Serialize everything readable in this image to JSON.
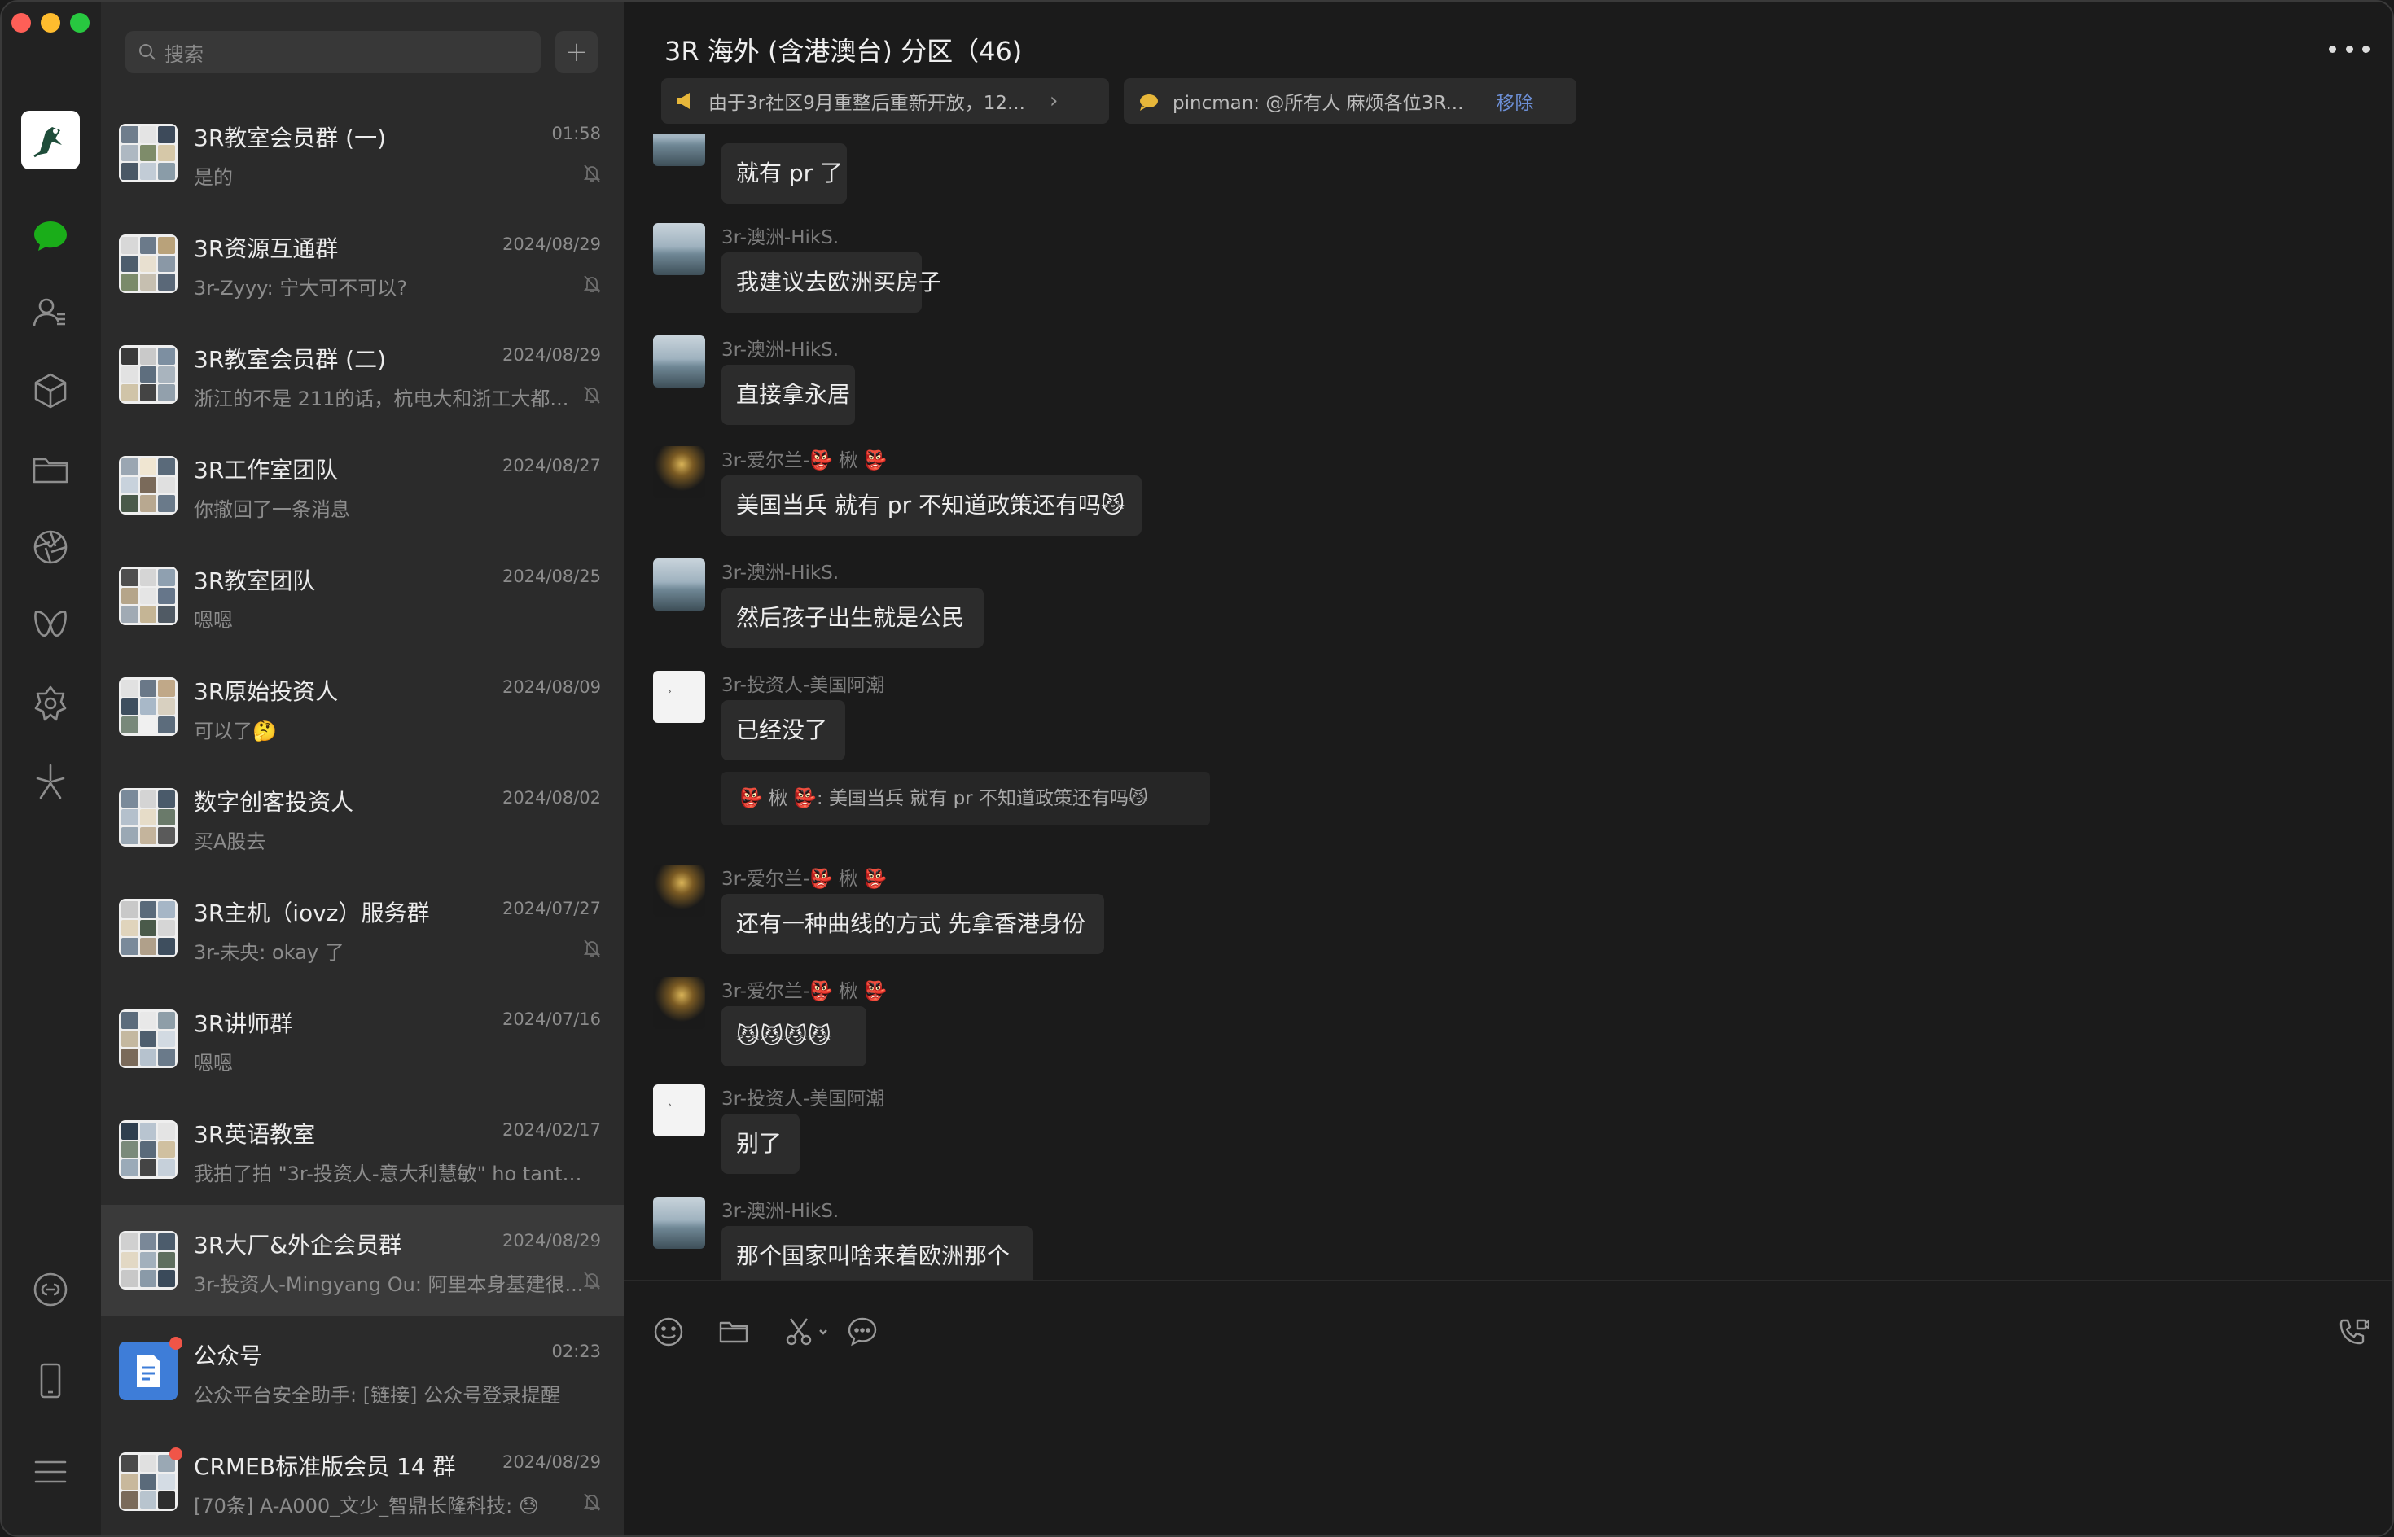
{
  "window": {
    "traffic_colors": [
      "#fe5f57",
      "#febc2e",
      "#28c840"
    ]
  },
  "rail": {
    "icons": [
      "chat-icon",
      "contacts-icon",
      "box-icon",
      "folder-icon",
      "moments-icon",
      "channels-icon",
      "mini-program-icon",
      "search-glint-icon",
      "link-icon",
      "phone-icon",
      "menu-icon"
    ]
  },
  "search": {
    "placeholder": "搜索"
  },
  "chats": [
    {
      "name": "3R教室会员群 (一)",
      "time": "01:58",
      "preview": "是的",
      "muted": true,
      "selected": false
    },
    {
      "name": "3R资源互通群",
      "time": "2024/08/29",
      "preview": "3r-Zyyy: 宁大可不可以?",
      "muted": true,
      "selected": false
    },
    {
      "name": "3R教室会员群 (二)",
      "time": "2024/08/29",
      "preview": "浙江的不是 211的话，杭电大和浙工大都...",
      "muted": true,
      "selected": false
    },
    {
      "name": "3R工作室团队",
      "time": "2024/08/27",
      "preview": "你撤回了一条消息",
      "muted": false,
      "selected": false
    },
    {
      "name": "3R教室团队",
      "time": "2024/08/25",
      "preview": "嗯嗯",
      "muted": false,
      "selected": false
    },
    {
      "name": "3R原始投资人",
      "time": "2024/08/09",
      "preview": "可以了🤔",
      "muted": false,
      "selected": false
    },
    {
      "name": "数字创客投资人",
      "time": "2024/08/02",
      "preview": "买A股去",
      "muted": false,
      "selected": false
    },
    {
      "name": "3R主机（iovz）服务群",
      "time": "2024/07/27",
      "preview": "3r-未央: okay 了",
      "muted": true,
      "selected": false
    },
    {
      "name": "3R讲师群",
      "time": "2024/07/16",
      "preview": "嗯嗯",
      "muted": false,
      "selected": false
    },
    {
      "name": "3R英语教室",
      "time": "2024/02/17",
      "preview": "我拍了拍 \"3r-投资人-意大利慧敏\" ho tanta f...",
      "muted": false,
      "selected": false
    },
    {
      "name": "3R大厂&外企会员群",
      "time": "2024/08/29",
      "preview": "3r-投资人-Mingyang Ou: 阿里本身基建很...",
      "muted": true,
      "selected": true
    },
    {
      "name": "公众号",
      "time": "02:23",
      "preview": "公众平台安全助手: [链接] 公众号登录提醒",
      "muted": false,
      "selected": false,
      "dot": true
    },
    {
      "name": "CRMEB标准版会员 14 群",
      "time": "2024/08/29",
      "preview": "[70条] A-A000_文少_智鼎长隆科技: 😓",
      "muted": true,
      "selected": false,
      "dot": true
    }
  ],
  "header": {
    "title": "3R 海外 (含港澳台) 分区（46)",
    "pin1": "由于3r社区9月重整后重新开放，12...",
    "pin2": "pincman: @所有人 麻烦各位3R...",
    "pin2_remove": "移除"
  },
  "messages": [
    {
      "sender": "",
      "text": "就有 pr 了",
      "avatar": "sea"
    },
    {
      "sender": "3r-澳洲-HikS.",
      "text": "我建议去欧洲买房子",
      "avatar": "sea"
    },
    {
      "sender": "3r-澳洲-HikS.",
      "text": "直接拿永居",
      "avatar": "sea"
    },
    {
      "sender": "3r-爱尔兰-👺 楸 👺",
      "text": "美国当兵 就有 pr 不知道政策还有吗😼",
      "avatar": "dark"
    },
    {
      "sender": "3r-澳洲-HikS.",
      "text": "然后孩子出生就是公民",
      "avatar": "sea"
    },
    {
      "sender": "3r-投资人-美国阿潮",
      "text": "已经没了",
      "avatar": "white"
    },
    {
      "sender": "3r-爱尔兰-👺 楸 👺",
      "text": "还有一种曲线的方式 先拿香港身份",
      "avatar": "dark"
    },
    {
      "sender": "3r-爱尔兰-👺 楸 👺",
      "text": "😼😼😼😼",
      "avatar": "dark"
    },
    {
      "sender": "3r-投资人-美国阿潮",
      "text": "别了",
      "avatar": "white"
    },
    {
      "sender": "3r-澳洲-HikS.",
      "text": "那个国家叫啥来着欧洲那个",
      "avatar": "sea"
    }
  ],
  "quote": {
    "text": "👺 楸 👺: 美国当兵 就有 pr 不知道政策还有吗😼"
  },
  "composer": {
    "tools": [
      "emoji-icon",
      "folder-icon",
      "scissors-icon",
      "chat-history-icon",
      "voice-call-icon"
    ]
  }
}
